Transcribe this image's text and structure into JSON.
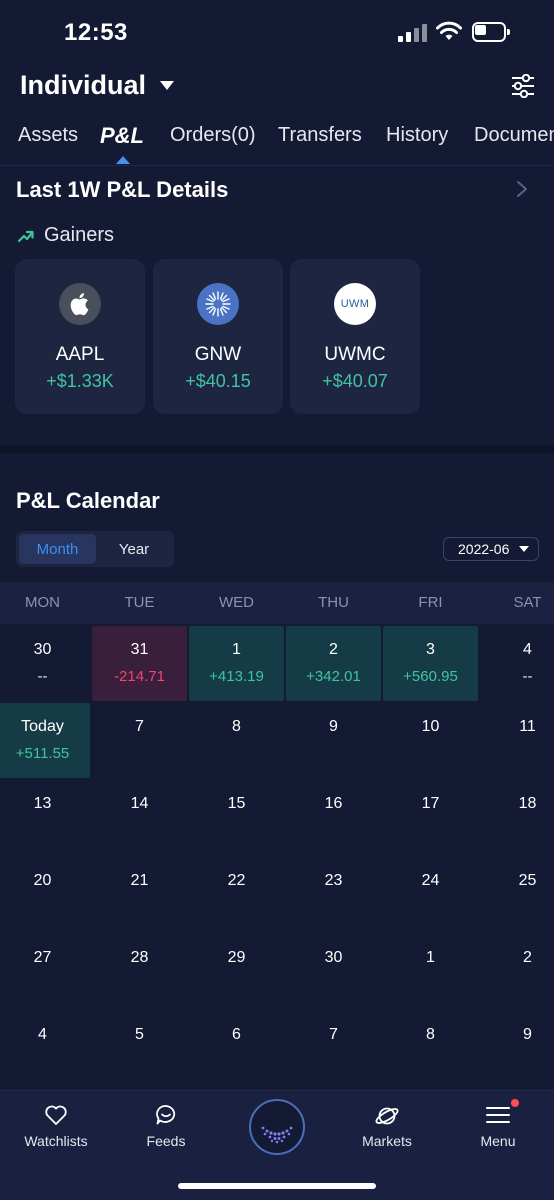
{
  "status_bar": {
    "time": "12:53"
  },
  "header": {
    "account": "Individual"
  },
  "tabs": [
    {
      "label": "Assets"
    },
    {
      "label": "P&L"
    },
    {
      "label": "Orders(0)"
    },
    {
      "label": "Transfers"
    },
    {
      "label": "History"
    },
    {
      "label": "Documents"
    }
  ],
  "pnl_details": {
    "title": "Last 1W P&L Details",
    "gainers_label": "Gainers",
    "cards": [
      {
        "ticker": "AAPL",
        "pnl": "+$1.33K",
        "logo_icon": "apple-icon"
      },
      {
        "ticker": "GNW",
        "pnl": "+$40.15",
        "logo_icon": "genworth-logo-icon"
      },
      {
        "ticker": "UWMC",
        "pnl": "+$40.07",
        "logo_icon": "uwm-logo-icon",
        "logo_text": "UWM"
      }
    ]
  },
  "calendar": {
    "title": "P&L Calendar",
    "view_options": [
      "Month",
      "Year"
    ],
    "selected_view": "Month",
    "selected_month": "2022-06",
    "weekdays": [
      "MON",
      "TUE",
      "WED",
      "THU",
      "FRI",
      "SAT"
    ],
    "weeks": [
      [
        {
          "day": "30",
          "value": "--",
          "kind": "neutral"
        },
        {
          "day": "31",
          "value": "-214.71",
          "kind": "loss"
        },
        {
          "day": "1",
          "value": "+413.19",
          "kind": "gain"
        },
        {
          "day": "2",
          "value": "+342.01",
          "kind": "gain"
        },
        {
          "day": "3",
          "value": "+560.95",
          "kind": "gain"
        },
        {
          "day": "4",
          "value": "--",
          "kind": "neutral"
        }
      ],
      [
        {
          "day": "Today",
          "value": "+511.55",
          "kind": "gain"
        },
        {
          "day": "7",
          "value": "",
          "kind": "empty"
        },
        {
          "day": "8",
          "value": "",
          "kind": "empty"
        },
        {
          "day": "9",
          "value": "",
          "kind": "empty"
        },
        {
          "day": "10",
          "value": "",
          "kind": "empty"
        },
        {
          "day": "11",
          "value": "",
          "kind": "empty"
        }
      ],
      [
        {
          "day": "13",
          "value": "",
          "kind": "empty"
        },
        {
          "day": "14",
          "value": "",
          "kind": "empty"
        },
        {
          "day": "15",
          "value": "",
          "kind": "empty"
        },
        {
          "day": "16",
          "value": "",
          "kind": "empty"
        },
        {
          "day": "17",
          "value": "",
          "kind": "empty"
        },
        {
          "day": "18",
          "value": "",
          "kind": "empty"
        }
      ],
      [
        {
          "day": "20",
          "value": "",
          "kind": "empty"
        },
        {
          "day": "21",
          "value": "",
          "kind": "empty"
        },
        {
          "day": "22",
          "value": "",
          "kind": "empty"
        },
        {
          "day": "23",
          "value": "",
          "kind": "empty"
        },
        {
          "day": "24",
          "value": "",
          "kind": "empty"
        },
        {
          "day": "25",
          "value": "",
          "kind": "empty"
        }
      ],
      [
        {
          "day": "27",
          "value": "",
          "kind": "empty"
        },
        {
          "day": "28",
          "value": "",
          "kind": "empty"
        },
        {
          "day": "29",
          "value": "",
          "kind": "empty"
        },
        {
          "day": "30",
          "value": "",
          "kind": "empty"
        },
        {
          "day": "1",
          "value": "",
          "kind": "empty"
        },
        {
          "day": "2",
          "value": "",
          "kind": "empty"
        }
      ],
      [
        {
          "day": "4",
          "value": "",
          "kind": "empty"
        },
        {
          "day": "5",
          "value": "",
          "kind": "empty"
        },
        {
          "day": "6",
          "value": "",
          "kind": "empty"
        },
        {
          "day": "7",
          "value": "",
          "kind": "empty"
        },
        {
          "day": "8",
          "value": "",
          "kind": "empty"
        },
        {
          "day": "9",
          "value": "",
          "kind": "empty"
        }
      ]
    ]
  },
  "bottom_nav": [
    {
      "label": "Watchlists",
      "icon": "heart-icon"
    },
    {
      "label": "Feeds",
      "icon": "chat-bubble-icon"
    },
    {
      "label": "",
      "icon": "home-orb-icon"
    },
    {
      "label": "Markets",
      "icon": "planet-icon"
    },
    {
      "label": "Menu",
      "icon": "hamburger-menu-icon"
    }
  ],
  "colors": {
    "background": "#141a33",
    "card": "#1e2541",
    "gain": "#3fc4a0",
    "loss": "#f0456c",
    "accent": "#3a91f5"
  }
}
